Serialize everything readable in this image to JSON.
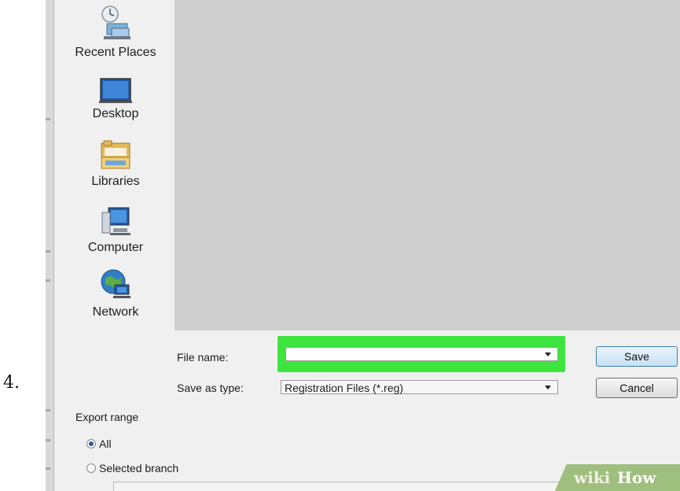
{
  "step_number": "4.",
  "nav": {
    "items": [
      {
        "label": "Recent Places",
        "icon": "recent-places-icon"
      },
      {
        "label": "Desktop",
        "icon": "desktop-icon"
      },
      {
        "label": "Libraries",
        "icon": "libraries-icon"
      },
      {
        "label": "Computer",
        "icon": "computer-icon"
      },
      {
        "label": "Network",
        "icon": "network-icon"
      }
    ]
  },
  "form": {
    "file_name_label": "File name:",
    "file_name_value": "",
    "save_as_type_label": "Save as type:",
    "save_as_type_value": "Registration Files (*.reg)"
  },
  "buttons": {
    "save": "Save",
    "cancel": "Cancel"
  },
  "export_range": {
    "title": "Export range",
    "options": [
      {
        "label": "All",
        "selected": true
      },
      {
        "label": "Selected branch",
        "selected": false
      }
    ]
  },
  "watermark": {
    "wiki": "wiki",
    "how": "How"
  },
  "colors": {
    "highlight": "#3fe53f",
    "file_list_bg": "#cfcfcf",
    "dialog_bg": "#f0f0f0"
  }
}
